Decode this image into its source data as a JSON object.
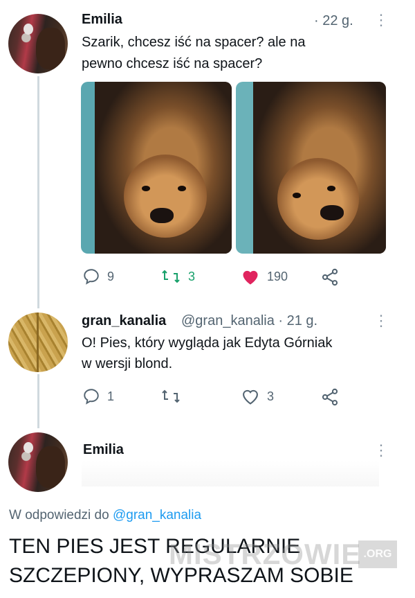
{
  "tweet1": {
    "name": "Emilia",
    "time": "· 22 g.",
    "text_line1": "Szarik, chcesz iść na spacer? ale na",
    "text_line2": "pewno chcesz iść na spacer?",
    "reply_count": "9",
    "retweet_count": "3",
    "like_count": "190"
  },
  "tweet2": {
    "name": "gran_kanalia",
    "handle_time": "@gran_kanalia · 21 g.",
    "text_line1": "O! Pies, który wygląda jak Edyta Górniak",
    "text_line2": "w wersji blond.",
    "reply_count": "1",
    "retweet_count": "",
    "like_count": "3"
  },
  "tweet3": {
    "name": "Emilia",
    "reply_prefix": "W odpowiedzi do ",
    "reply_mention": "@gran_kanalia",
    "text_line1": "TEN PIES JEST REGULARNIE",
    "text_line2": "SZCZEPIONY, WYPRASZAM SOBIE"
  },
  "watermark": {
    "text": "MISTRZOWIE",
    "badge": ".ORG"
  },
  "colors": {
    "like_active": "#e0245e",
    "mention_blue": "#1d9bf0",
    "retweet_green": "#17a06a",
    "muted_gray": "#536471"
  },
  "icons": [
    "reply-icon",
    "retweet-icon",
    "like-icon",
    "share-icon",
    "more-options-icon"
  ]
}
